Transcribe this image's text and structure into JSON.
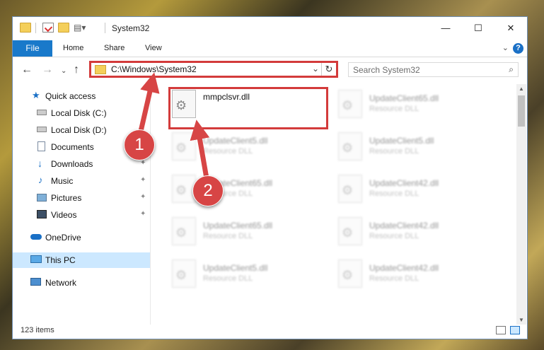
{
  "window": {
    "title": "System32",
    "controls": {
      "minimize": "—",
      "maximize": "☐",
      "close": "✕"
    }
  },
  "ribbon": {
    "tabs": [
      "File",
      "Home",
      "Share",
      "View"
    ],
    "help": "?",
    "expand": "⌄"
  },
  "nav": {
    "back": "←",
    "forward": "→",
    "recent": "⌄",
    "up": "↑",
    "address": "C:\\Windows\\System32",
    "address_chevron": "⌄",
    "refresh": "↻",
    "search_placeholder": "Search System32"
  },
  "sidebar": {
    "items": [
      {
        "label": "Quick access",
        "icon": "star-icon"
      },
      {
        "label": "Local Disk (C:)",
        "icon": "drive-icon"
      },
      {
        "label": "Local Disk (D:)",
        "icon": "drive-icon"
      },
      {
        "label": "Documents",
        "icon": "documents-icon"
      },
      {
        "label": "Downloads",
        "icon": "download-icon",
        "pinned": true
      },
      {
        "label": "Music",
        "icon": "music-icon",
        "pinned": true
      },
      {
        "label": "Pictures",
        "icon": "pictures-icon",
        "pinned": true
      },
      {
        "label": "Videos",
        "icon": "videos-icon",
        "pinned": true
      },
      {
        "label": "OneDrive",
        "icon": "cloud-icon"
      },
      {
        "label": "This PC",
        "icon": "computer-icon",
        "selected": true
      },
      {
        "label": "Network",
        "icon": "network-icon"
      }
    ],
    "pin_glyph": "📌"
  },
  "files": [
    {
      "name": "mmpclsvr.dll",
      "type": ""
    },
    {
      "name": "UpdateClient65.dll",
      "type": "Resource DLL"
    },
    {
      "name": "UpdateClient5.dll",
      "type": "Resource DLL"
    },
    {
      "name": "UpdateClient5.dll",
      "type": "Resource DLL"
    },
    {
      "name": "UpdateClient65.dll",
      "type": "Resource DLL"
    },
    {
      "name": "UpdateClient42.dll",
      "type": "Resource DLL"
    },
    {
      "name": "UpdateClient65.dll",
      "type": "Resource DLL"
    },
    {
      "name": "UpdateClient42.dll",
      "type": "Resource DLL"
    },
    {
      "name": "UpdateClient5.dll",
      "type": "Resource DLL"
    },
    {
      "name": "UpdateClient42.dll",
      "type": "Resource DLL"
    }
  ],
  "status": {
    "item_count": "123 items"
  },
  "callouts": {
    "step1": "1",
    "step2": "2"
  },
  "colors": {
    "accent": "#1979ca",
    "callout": "#d74545",
    "selected_bg": "#cce8ff"
  }
}
